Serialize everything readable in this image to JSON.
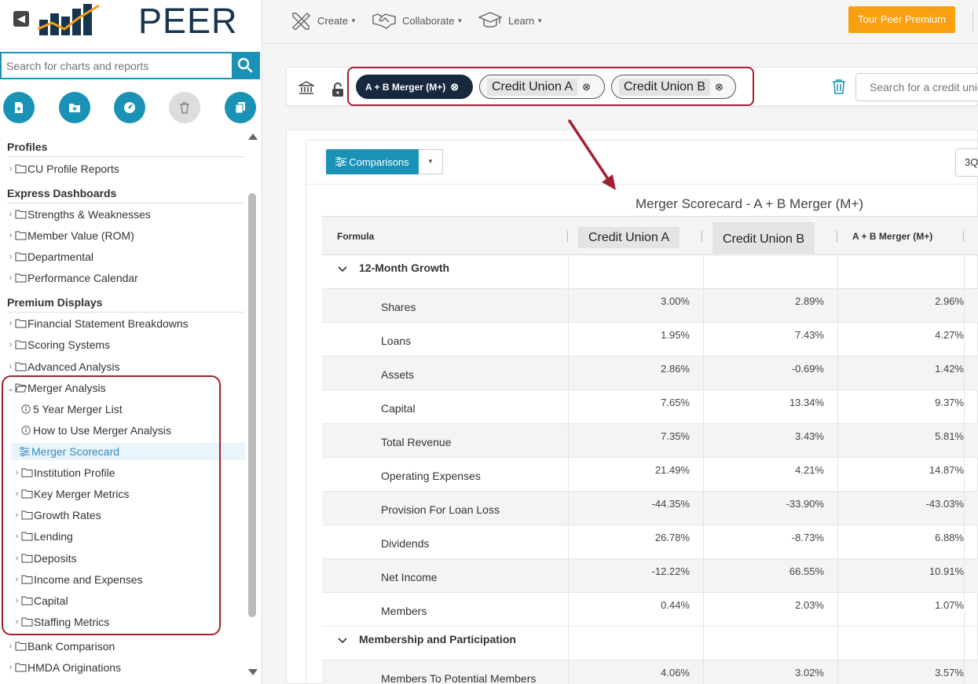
{
  "sidebar": {
    "logo_text": "PEER",
    "search_placeholder": "Search for charts and reports",
    "tools": [
      "new-report-icon",
      "new-folder-icon",
      "dashboard-icon",
      "delete-icon",
      "copy-icon"
    ],
    "sections": [
      {
        "heading": "Profiles",
        "items": [
          {
            "label": "CU Profile Reports",
            "type": "folder"
          }
        ]
      },
      {
        "heading": "Express Dashboards",
        "items": [
          {
            "label": "Strengths & Weaknesses",
            "type": "folder"
          },
          {
            "label": "Member Value (ROM)",
            "type": "folder"
          },
          {
            "label": "Departmental",
            "type": "folder"
          },
          {
            "label": "Performance Calendar",
            "type": "folder"
          }
        ]
      },
      {
        "heading": "Premium Displays",
        "items": [
          {
            "label": "Financial Statement Breakdowns",
            "type": "folder"
          },
          {
            "label": "Scoring Systems",
            "type": "folder"
          },
          {
            "label": "Advanced Analysis",
            "type": "folder"
          },
          {
            "label": "Merger Analysis",
            "type": "folder-open"
          },
          {
            "label": "5 Year Merger List",
            "type": "info",
            "child": true
          },
          {
            "label": "How to Use Merger Analysis",
            "type": "info",
            "child": true
          },
          {
            "label": "Merger Scorecard",
            "type": "report",
            "child": true,
            "active": true
          },
          {
            "label": "Institution Profile",
            "type": "folder",
            "child": true
          },
          {
            "label": "Key Merger Metrics",
            "type": "folder",
            "child": true
          },
          {
            "label": "Growth Rates",
            "type": "folder",
            "child": true
          },
          {
            "label": "Lending",
            "type": "folder",
            "child": true
          },
          {
            "label": "Deposits",
            "type": "folder",
            "child": true
          },
          {
            "label": "Income and Expenses",
            "type": "folder",
            "child": true
          },
          {
            "label": "Capital",
            "type": "folder",
            "child": true
          },
          {
            "label": "Staffing Metrics",
            "type": "folder",
            "child": true
          },
          {
            "label": "Bank Comparison",
            "type": "folder"
          },
          {
            "label": "HMDA Originations",
            "type": "folder"
          }
        ]
      }
    ]
  },
  "topnav": {
    "items": [
      {
        "label": "Create",
        "icon": "pencil-ruler-icon"
      },
      {
        "label": "Collaborate",
        "icon": "handshake-icon"
      },
      {
        "label": "Learn",
        "icon": "graduation-cap-icon"
      }
    ],
    "premium_label": "Tour Peer Premium"
  },
  "filterbar": {
    "chips": [
      {
        "label": "A + B Merger (M+)",
        "style": "dark"
      },
      {
        "label": "Credit Union A",
        "style": "light"
      },
      {
        "label": "Credit Union B",
        "style": "light"
      }
    ],
    "search_placeholder": "Search for a credit union"
  },
  "report": {
    "comparisons_label": "Comparisons",
    "period_label": "3Q",
    "title": "Merger Scorecard - A + B Merger (M+)",
    "columns": [
      "Formula",
      "Credit Union A",
      "Credit Union B",
      "A + B Merger (M+)"
    ],
    "groups": [
      {
        "label": "12-Month Growth",
        "rows": [
          {
            "label": "Shares",
            "values": [
              "3.00%",
              "2.89%",
              "2.96%"
            ]
          },
          {
            "label": "Loans",
            "values": [
              "1.95%",
              "7.43%",
              "4.27%"
            ]
          },
          {
            "label": "Assets",
            "values": [
              "2.86%",
              "-0.69%",
              "1.42%"
            ]
          },
          {
            "label": "Capital",
            "values": [
              "7.65%",
              "13.34%",
              "9.37%"
            ]
          },
          {
            "label": "Total Revenue",
            "values": [
              "7.35%",
              "3.43%",
              "5.81%"
            ]
          },
          {
            "label": "Operating Expenses",
            "values": [
              "21.49%",
              "4.21%",
              "14.87%"
            ]
          },
          {
            "label": "Provision For Loan Loss",
            "values": [
              "-44.35%",
              "-33.90%",
              "-43.03%"
            ]
          },
          {
            "label": "Dividends",
            "values": [
              "26.78%",
              "-8.73%",
              "6.88%"
            ]
          },
          {
            "label": "Net Income",
            "values": [
              "-12.22%",
              "66.55%",
              "10.91%"
            ]
          },
          {
            "label": "Members",
            "values": [
              "0.44%",
              "2.03%",
              "1.07%"
            ]
          }
        ]
      },
      {
        "label": "Membership and Participation",
        "rows": [
          {
            "label": "Members To Potential Members",
            "values": [
              "4.06%",
              "3.02%",
              "3.57%"
            ]
          }
        ]
      }
    ]
  },
  "colors": {
    "accent": "#1a92b5",
    "highlight": "#a3202e",
    "premium": "#f8a00f",
    "logo": "#17344f"
  }
}
